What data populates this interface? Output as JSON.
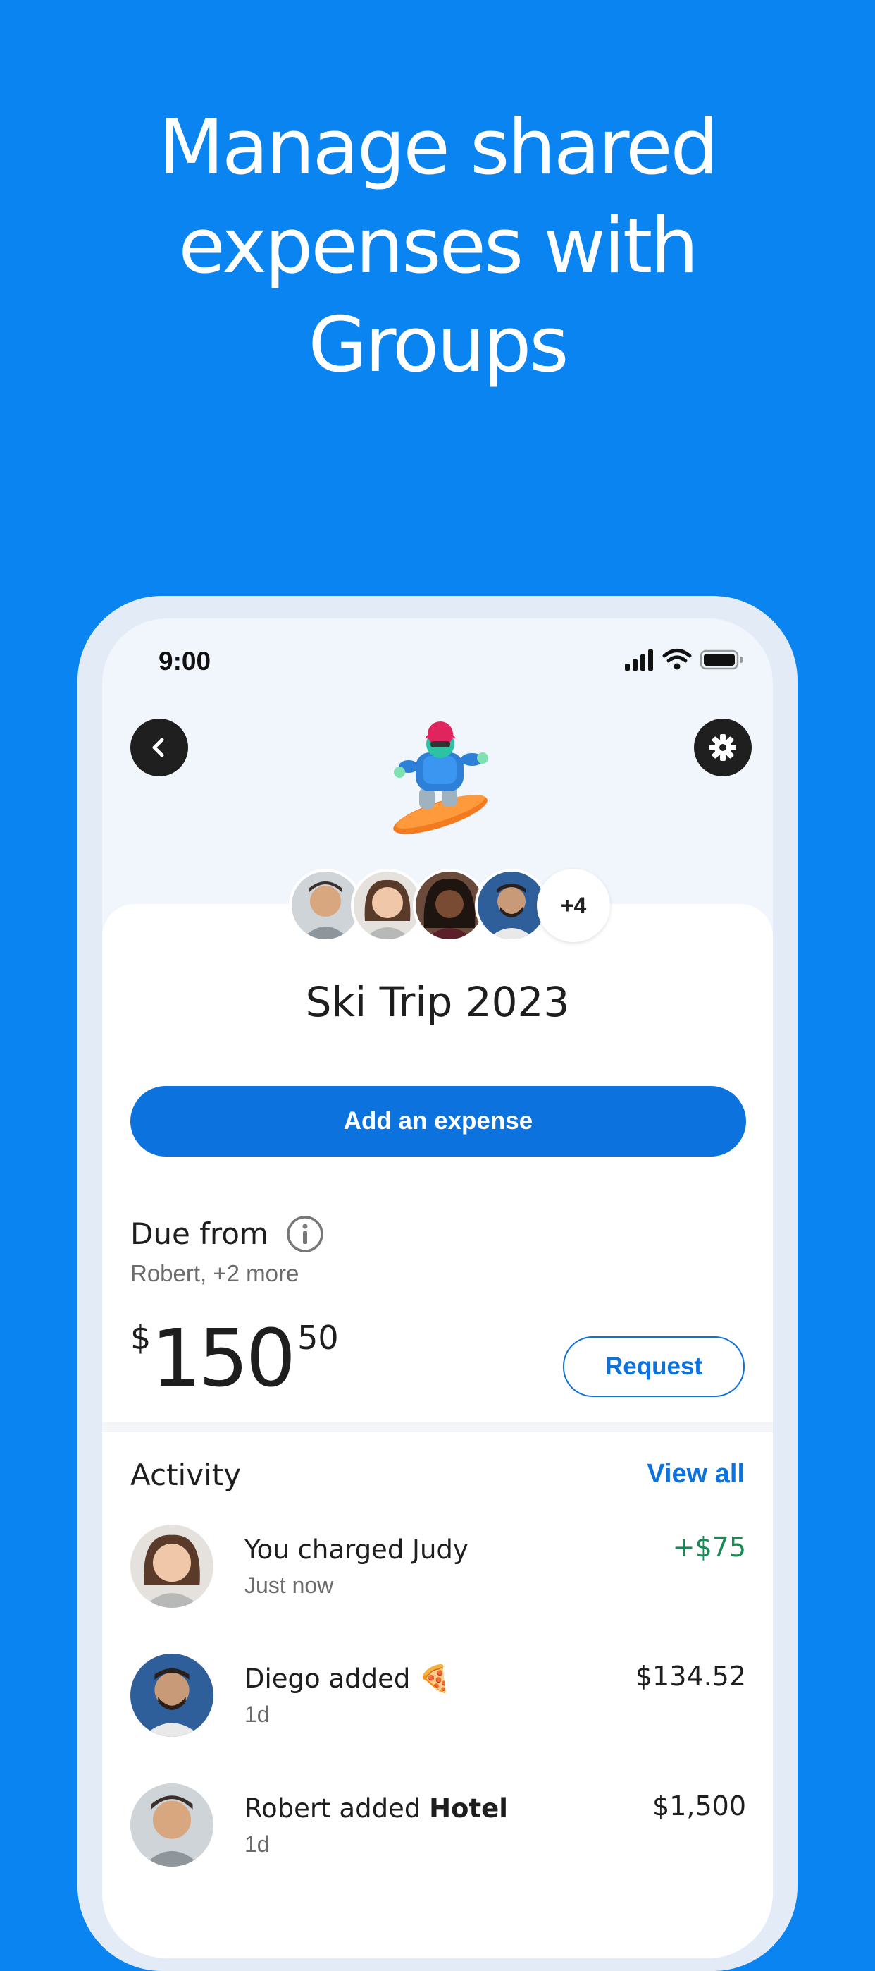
{
  "headline": {
    "line1": "Manage shared",
    "line2": "expenses with",
    "line3": "Groups"
  },
  "status_bar": {
    "time": "9:00"
  },
  "group": {
    "title": "Ski Trip 2023",
    "emoji_icon": "snowboarder-icon",
    "extra_members": "+4"
  },
  "actions": {
    "add_expense": "Add an expense"
  },
  "due": {
    "label": "Due from",
    "subtitle": "Robert, +2 more",
    "currency": "$",
    "whole": "150",
    "cents": "50",
    "request_label": "Request"
  },
  "activity": {
    "title": "Activity",
    "view_all": "View all",
    "items": [
      {
        "title": "You charged Judy",
        "title_bold": "",
        "emoji": "",
        "subtitle": "Just now",
        "amount": "+$75",
        "positive": true
      },
      {
        "title": "Diego added ",
        "title_bold": "",
        "emoji": "🍕",
        "subtitle": "1d",
        "amount": "$134.52",
        "positive": false
      },
      {
        "title": "Robert added ",
        "title_bold": "Hotel",
        "emoji": "",
        "subtitle": "1d",
        "amount": "$1,500",
        "positive": false
      }
    ]
  },
  "colors": {
    "background": "#0a84f0",
    "primary": "#0c72dd",
    "positive": "#1a8a55"
  }
}
